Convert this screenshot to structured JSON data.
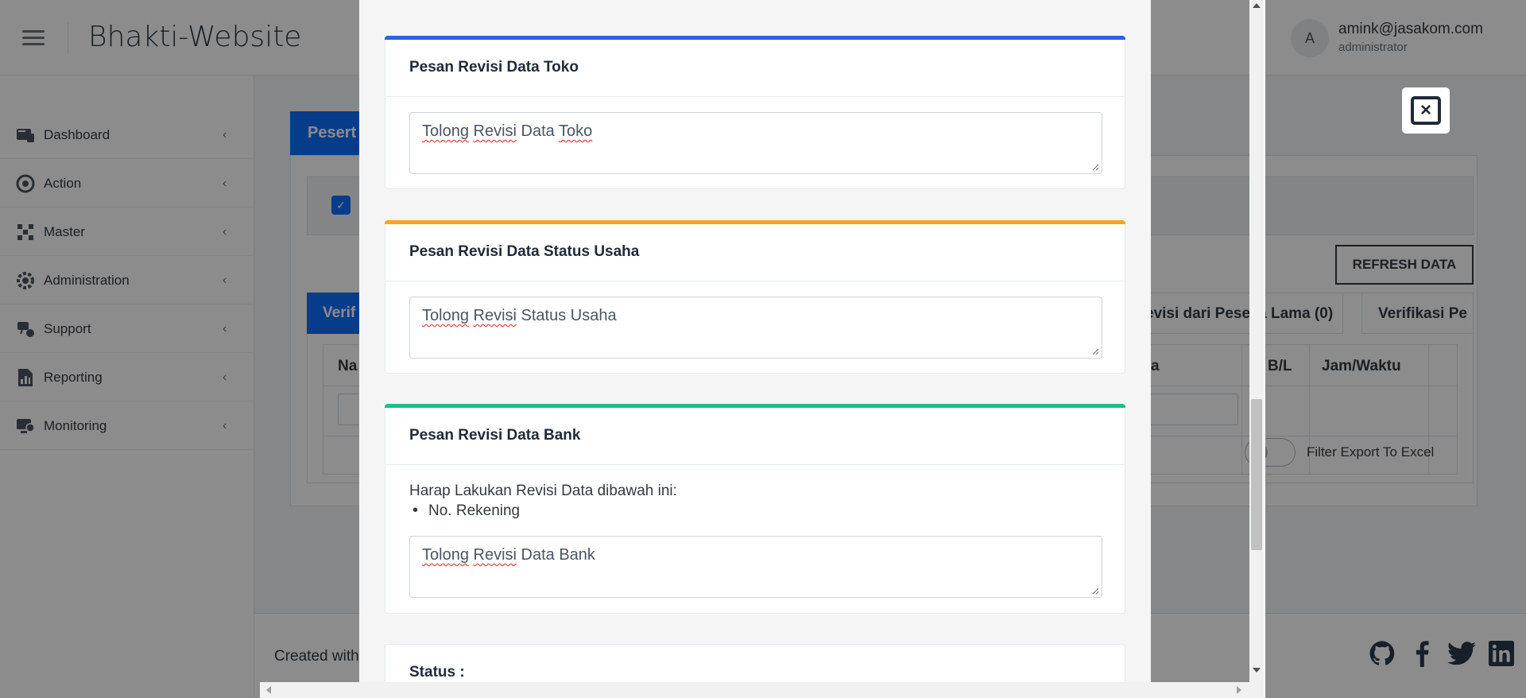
{
  "app": {
    "brand": "Bhakti-Website",
    "user": {
      "avatar_letter": "A",
      "email": "amink@jasakom.com",
      "role": "administrator"
    }
  },
  "sidebar": {
    "items": [
      {
        "label": "Dashboard",
        "icon": "dashboard-icon"
      },
      {
        "label": "Action",
        "icon": "action-icon"
      },
      {
        "label": "Master",
        "icon": "master-icon"
      },
      {
        "label": "Administration",
        "icon": "administration-icon"
      },
      {
        "label": "Support",
        "icon": "support-icon"
      },
      {
        "label": "Reporting",
        "icon": "reporting-icon"
      },
      {
        "label": "Monitoring",
        "icon": "monitoring-icon"
      }
    ]
  },
  "background": {
    "tab_peserta": "Pesert",
    "refresh_button": "REFRESH DATA",
    "tab_verif": "Verif",
    "tab_revisi": "evisi dari Pese ta Lama (0)",
    "tab_verifikasi": "Verifikasi Pe",
    "col_na": "Na",
    "col_a": "a",
    "col_bl": "B/L",
    "col_jam": "Jam/Waktu",
    "filter_export": "Filter Export To Excel",
    "footer_text": "Created with"
  },
  "modal": {
    "toko": {
      "title": "Pesan Revisi Data Toko",
      "value_parts": [
        "Tolong",
        "Revisi",
        "Data",
        "Toko"
      ]
    },
    "status_usaha": {
      "title": "Pesan Revisi Data Status Usaha",
      "value_parts": [
        "Tolong",
        "Revisi",
        "Status Usaha"
      ]
    },
    "bank": {
      "title": "Pesan Revisi Data Bank",
      "instruction": "Harap Lakukan Revisi Data dibawah ini:",
      "items": [
        "No. Rekening"
      ],
      "value_parts": [
        "Tolong",
        "Revisi",
        "Data Bank"
      ]
    },
    "status_label": "Status :"
  },
  "colors": {
    "toko_accent": "#2f5fe3",
    "status_usaha_accent": "#f5a623",
    "bank_accent": "#1dbf86"
  }
}
